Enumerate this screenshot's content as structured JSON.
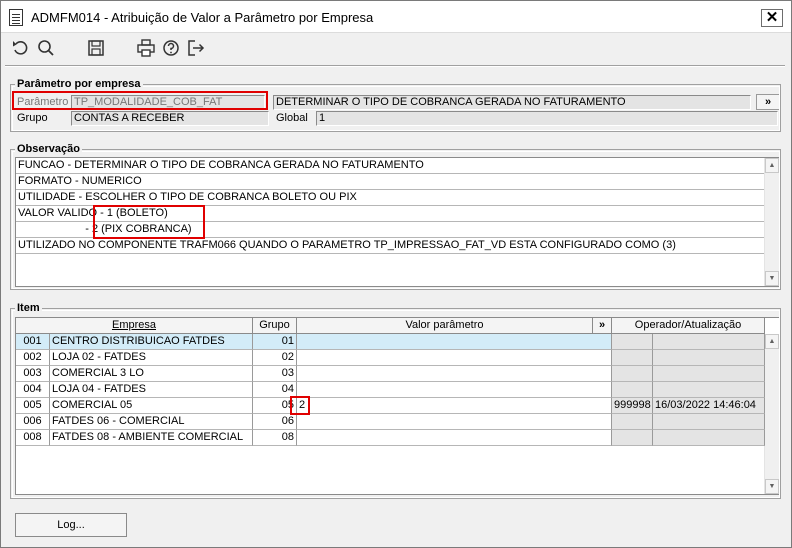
{
  "window": {
    "title": "ADMFM014 - Atribuição de Valor a Parâmetro por Empresa",
    "close": "✕"
  },
  "toolbar": [
    "undo-icon",
    "search-icon",
    "save-icon",
    "print-icon",
    "help-icon",
    "exit-icon"
  ],
  "param": {
    "section": "Parâmetro por empresa",
    "param_label": "Parâmetro",
    "param_value": "TP_MODALIDADE_COB_FAT",
    "description": "DETERMINAR O TIPO DE COBRANCA GERADA NO FATURAMENTO",
    "more": "»",
    "grupo_label": "Grupo",
    "grupo_value": "CONTAS A RECEBER",
    "global_label": "Global",
    "global_value": "1"
  },
  "obs": {
    "section": "Observação",
    "lines": [
      "FUNCAO - DETERMINAR O TIPO DE COBRANCA GERADA NO FATURAMENTO",
      "FORMATO - NUMERICO",
      "UTILIDADE - ESCOLHER O TIPO DE COBRANCA BOLETO OU PIX",
      "VALOR VALIDO - 1 (BOLETO)",
      "                      - 2 (PIX COBRANCA)",
      "UTILIZADO NO COMPONENTE TRAFM066 QUANDO O PARAMETRO TP_IMPRESSAO_FAT_VD ESTA CONFIGURADO COMO (3)"
    ]
  },
  "item": {
    "section": "Item",
    "headers": {
      "empresa": "Empresa",
      "grupo": "Grupo",
      "valor": "Valor parâmetro",
      "more": "»",
      "operador": "Operador/Atualização"
    },
    "rows": [
      {
        "code": "001",
        "name": "CENTRO DISTRIBUICAO FATDES",
        "grupo": "01",
        "valor": "",
        "op": "",
        "upd": ""
      },
      {
        "code": "002",
        "name": "LOJA 02 - FATDES",
        "grupo": "02",
        "valor": "",
        "op": "",
        "upd": ""
      },
      {
        "code": "003",
        "name": "COMERCIAL 3 LO",
        "grupo": "03",
        "valor": "",
        "op": "",
        "upd": ""
      },
      {
        "code": "004",
        "name": "LOJA 04 - FATDES",
        "grupo": "04",
        "valor": "",
        "op": "",
        "upd": ""
      },
      {
        "code": "005",
        "name": "COMERCIAL 05",
        "grupo": "05",
        "valor": "2",
        "op": "999998",
        "upd": "16/03/2022 14:46:04"
      },
      {
        "code": "006",
        "name": "FATDES 06 - COMERCIAL",
        "grupo": "06",
        "valor": "",
        "op": "",
        "upd": ""
      },
      {
        "code": "008",
        "name": "FATDES 08 - AMBIENTE COMERCIAL",
        "grupo": "08",
        "valor": "",
        "op": "",
        "upd": ""
      }
    ]
  },
  "footer": {
    "log_button": "Log..."
  }
}
